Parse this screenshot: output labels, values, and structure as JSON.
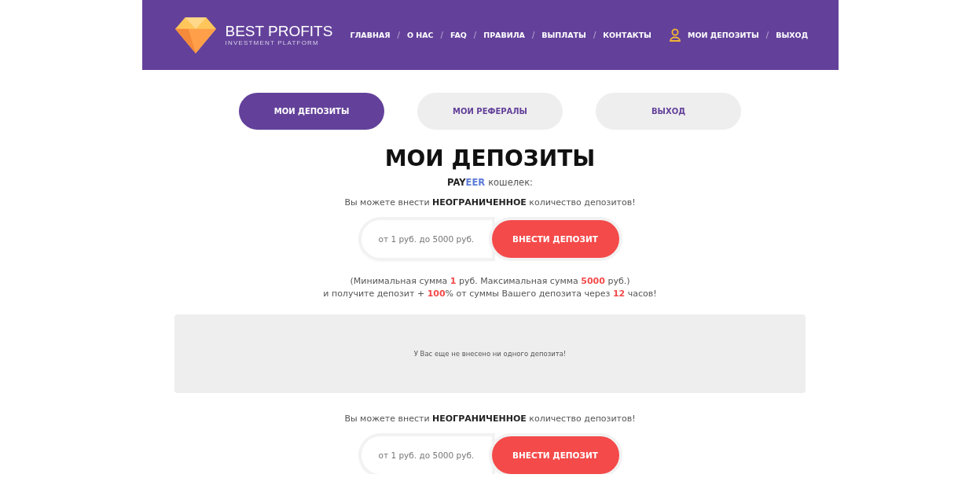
{
  "header": {
    "logo": {
      "title": "BEST PROFITS",
      "subtitle": "INVESTMENT PLATFORM"
    },
    "nav": [
      {
        "label": "ГЛАВНАЯ",
        "kind": "link"
      },
      {
        "label": "/",
        "kind": "separator"
      },
      {
        "label": "О НАС",
        "kind": "link"
      },
      {
        "label": "/",
        "kind": "separator"
      },
      {
        "label": "FAQ",
        "kind": "link"
      },
      {
        "label": "/",
        "kind": "separator"
      },
      {
        "label": "ПРАВИЛА",
        "kind": "link"
      },
      {
        "label": "/",
        "kind": "separator"
      },
      {
        "label": "ВЫПЛАТЫ",
        "kind": "link"
      },
      {
        "label": "/",
        "kind": "separator"
      },
      {
        "label": "КОНТАКТЫ",
        "kind": "link"
      },
      {
        "label": "МОИ ДЕПОЗИТЫ",
        "kind": "account"
      },
      {
        "label": "/",
        "kind": "separator"
      },
      {
        "label": "ВЫХОД",
        "kind": "link"
      }
    ]
  },
  "tabs": [
    {
      "label": "МОИ ДЕПОЗИТЫ",
      "selected": true
    },
    {
      "label": "МОИ РЕФЕРАЛЫ",
      "selected": false
    },
    {
      "label": "ВЫХОД",
      "selected": false
    }
  ],
  "title": "МОИ ДЕПОЗИТЫ",
  "wallet": {
    "brand_start": "PAY",
    "brand_end": "EER",
    "label": "кошелек:"
  },
  "info": "Вы можете внести **НЕОГРАНИЧЕННОЕ** количество депозитов!",
  "form": {
    "placeholder": "от 1 руб. до 5000 руб.",
    "button": "ВНЕСТИ ДЕПОЗИТ"
  },
  "note": [
    "(Минимальная сумма **1** руб. Максимальная сумма **5000** руб.)",
    "и получите депозит + **100**% от суммы Вашего депозита через **12** часов!"
  ],
  "empty_message": "У Вас еще не внесено ни одного депозита!",
  "info_bottom": "Вы можете внести **НЕОГРАНИЧЕННОЕ** количество депозитов!",
  "form_bottom": {
    "placeholder": "от 1 руб. до 5000 руб.",
    "button": "ВНЕСТИ ДЕПОЗИТ"
  }
}
